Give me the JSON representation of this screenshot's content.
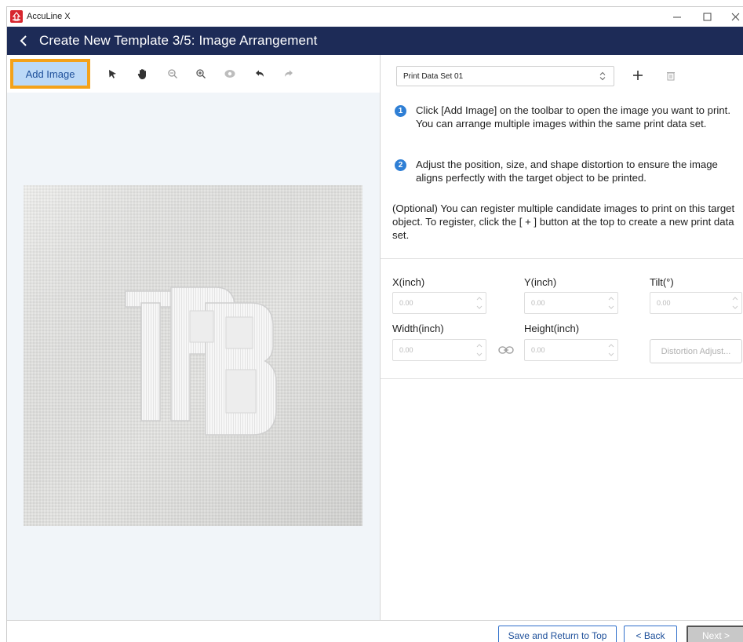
{
  "window": {
    "app_title": "AccuLine X",
    "minimize_glyph": "—",
    "maximize_glyph": "☐",
    "close_glyph": "✕"
  },
  "header": {
    "title": "Create New Template 3/5: Image Arrangement"
  },
  "toolbar": {
    "add_image_label": "Add Image",
    "tools": [
      "select-arrow-icon",
      "pan-hand-icon",
      "zoom-out-icon",
      "zoom-in-icon",
      "preview-eye-icon",
      "undo-icon",
      "redo-icon"
    ],
    "highlight_color": "#f4a21a"
  },
  "canvas": {
    "image_subject": "white embroidered TPB monogram on canvas fabric"
  },
  "print_data": {
    "selected_set": "Print Data Set 01",
    "add_icon": "plus-icon",
    "delete_icon": "trash-icon"
  },
  "instructions": {
    "step1_num": "1",
    "step1_text": "Click [Add Image] on the toolbar to open the image you want to print. You can arrange multiple images within the same print data set.",
    "step2_num": "2",
    "step2_text": "Adjust the position, size, and shape distortion to ensure the image aligns perfectly with the target object to be printed.",
    "optional_text": "(Optional) You can register multiple candidate images to print on this target object. To register, click the [ + ] button at the top to create a new print data set."
  },
  "fields": {
    "x_label": "X(inch)",
    "x_value": "0.00",
    "y_label": "Y(inch)",
    "y_value": "0.00",
    "tilt_label": "Tilt(°)",
    "tilt_value": "0.00",
    "width_label": "Width(inch)",
    "width_value": "0.00",
    "height_label": "Height(inch)",
    "height_value": "0.00",
    "distortion_label": "Distortion Adjust..."
  },
  "footer": {
    "save_label": "Save and Return to Top",
    "back_label": "< Back",
    "next_label": "Next >"
  },
  "colors": {
    "header_bg": "#1d2b57",
    "accent_blue": "#2f7fd5",
    "logo_red": "#d7262e"
  }
}
